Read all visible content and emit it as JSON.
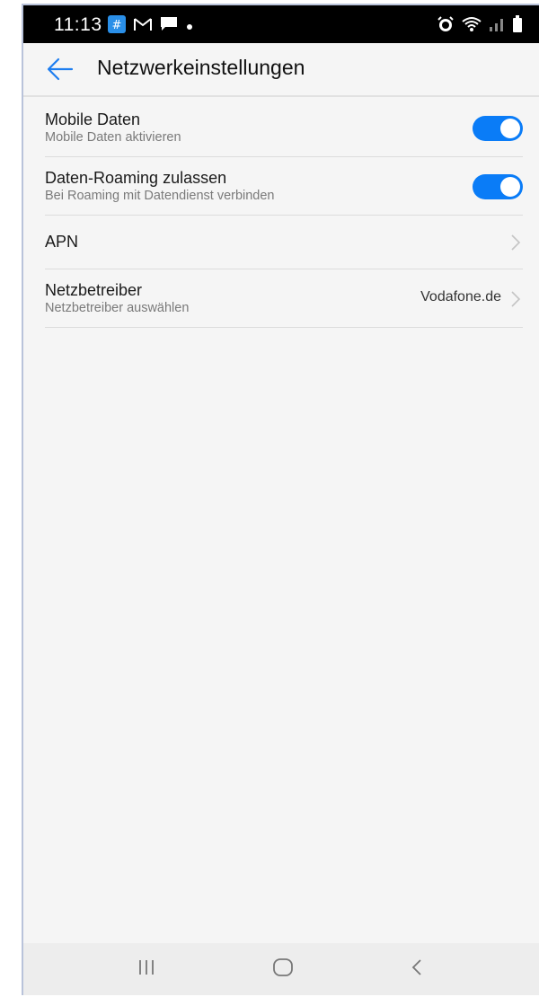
{
  "status_bar": {
    "time": "11:13",
    "left_icons": [
      "hashtag-app-icon",
      "gmail-icon",
      "message-icon",
      "dot-icon"
    ],
    "right_icons": [
      "alarm-icon",
      "wifi-icon",
      "signal-icon",
      "battery-icon"
    ]
  },
  "app_bar": {
    "title": "Netzwerkeinstellungen",
    "back_icon": "arrow-left-icon"
  },
  "settings": [
    {
      "label": "Mobile Daten",
      "subtitle": "Mobile Daten aktivieren",
      "toggle_on": true
    },
    {
      "label": "Daten-Roaming zulassen",
      "subtitle": "Bei Roaming mit Datendienst verbinden",
      "toggle_on": true
    },
    {
      "label": "APN"
    },
    {
      "label": "Netzbetreiber",
      "subtitle": "Netzbetreiber auswählen",
      "value": "Vodafone.de"
    }
  ],
  "nav_bar": {
    "buttons": [
      "recents-icon",
      "home-icon",
      "back-icon"
    ]
  },
  "colors": {
    "accent": "#0a7cf7",
    "background": "#f5f5f5",
    "status_bar": "#000000"
  }
}
